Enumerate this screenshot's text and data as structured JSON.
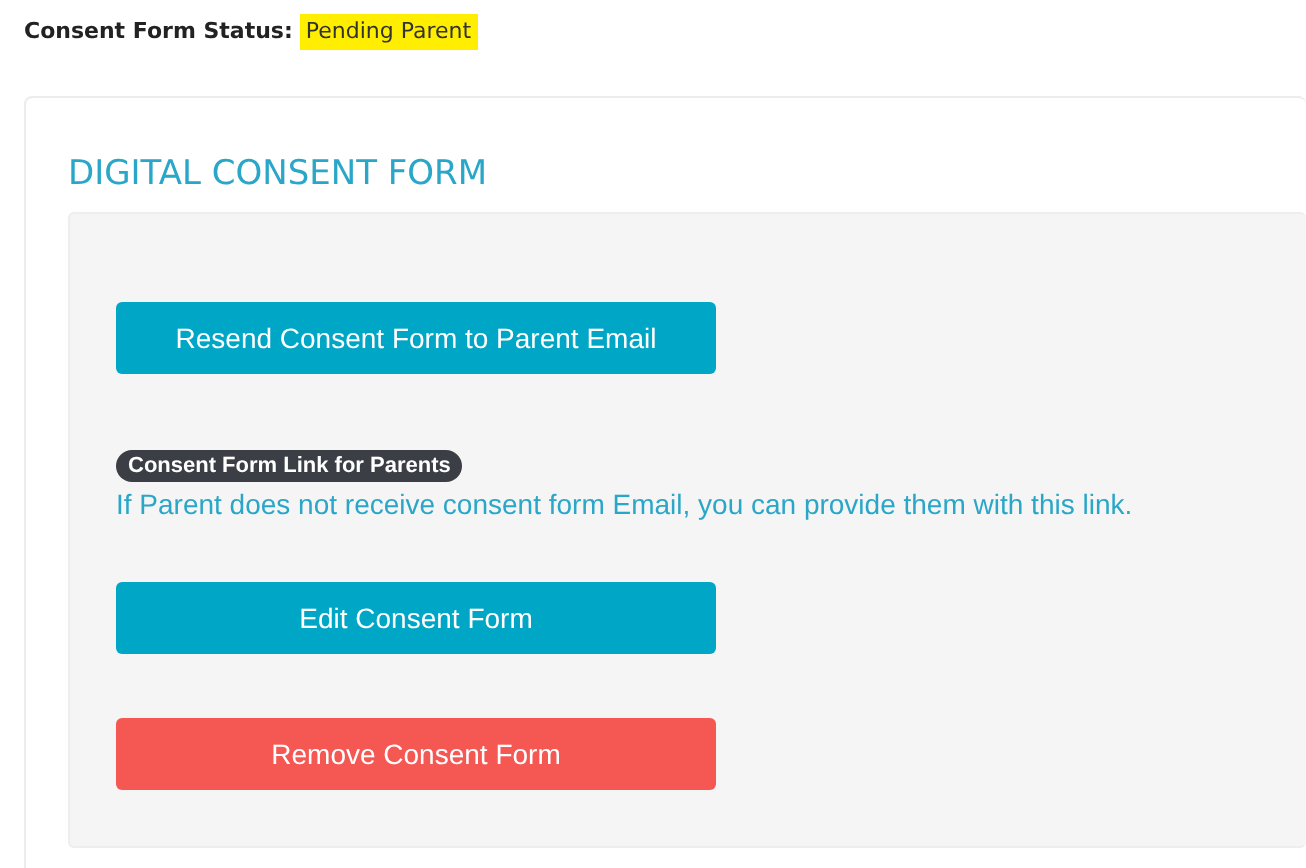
{
  "status": {
    "label": "Consent Form Status:",
    "value": "Pending Parent"
  },
  "card": {
    "title": "DIGITAL CONSENT FORM",
    "items": [
      {
        "kind": "primary-button",
        "label": "Resend Consent Form to Parent Email"
      },
      {
        "kind": "note",
        "badge": "Consent Form Link for Parents",
        "text": "If Parent does not receive consent form Email, you can provide them with this link."
      },
      {
        "kind": "primary-button",
        "label": "Edit Consent Form"
      },
      {
        "kind": "danger-button",
        "label": "Remove Consent Form"
      }
    ]
  }
}
